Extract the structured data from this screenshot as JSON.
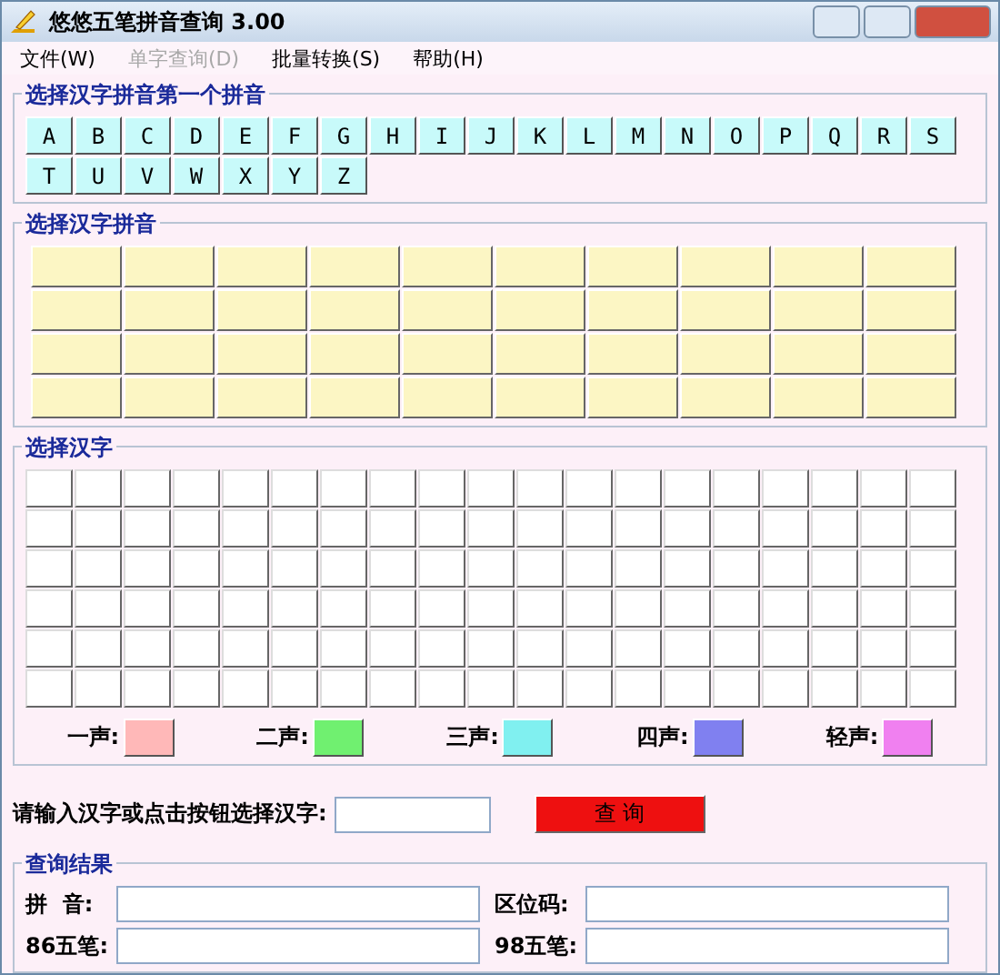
{
  "window": {
    "title": "悠悠五笔拼音查询 3.00"
  },
  "menu": [
    {
      "label": "文件(W)",
      "disabled": false
    },
    {
      "label": "单字查询(D)",
      "disabled": true
    },
    {
      "label": "批量转换(S)",
      "disabled": false
    },
    {
      "label": "帮助(H)",
      "disabled": false
    }
  ],
  "initials": {
    "title": "选择汉字拼音第一个拼音",
    "letters": [
      "A",
      "B",
      "C",
      "D",
      "E",
      "F",
      "G",
      "H",
      "I",
      "J",
      "K",
      "L",
      "M",
      "N",
      "O",
      "P",
      "Q",
      "R",
      "S",
      "T",
      "U",
      "V",
      "W",
      "X",
      "Y",
      "Z"
    ]
  },
  "pinyin": {
    "title": "选择汉字拼音"
  },
  "hanzi": {
    "title": "选择汉字"
  },
  "tones": [
    {
      "label": "一声:",
      "color": "#ffb8b8"
    },
    {
      "label": "二声:",
      "color": "#70f070"
    },
    {
      "label": "三声:",
      "color": "#80f0f0"
    },
    {
      "label": "四声:",
      "color": "#8080f0"
    },
    {
      "label": "轻声:",
      "color": "#f080f0"
    }
  ],
  "input": {
    "label": "请输入汉字或点击按钮选择汉字:",
    "button": "查 询"
  },
  "results": {
    "title": "查询结果",
    "fields": [
      {
        "label": "拼  音:"
      },
      {
        "label": "区位码:"
      },
      {
        "label": "86五笔:"
      },
      {
        "label": "98五笔:"
      }
    ]
  }
}
